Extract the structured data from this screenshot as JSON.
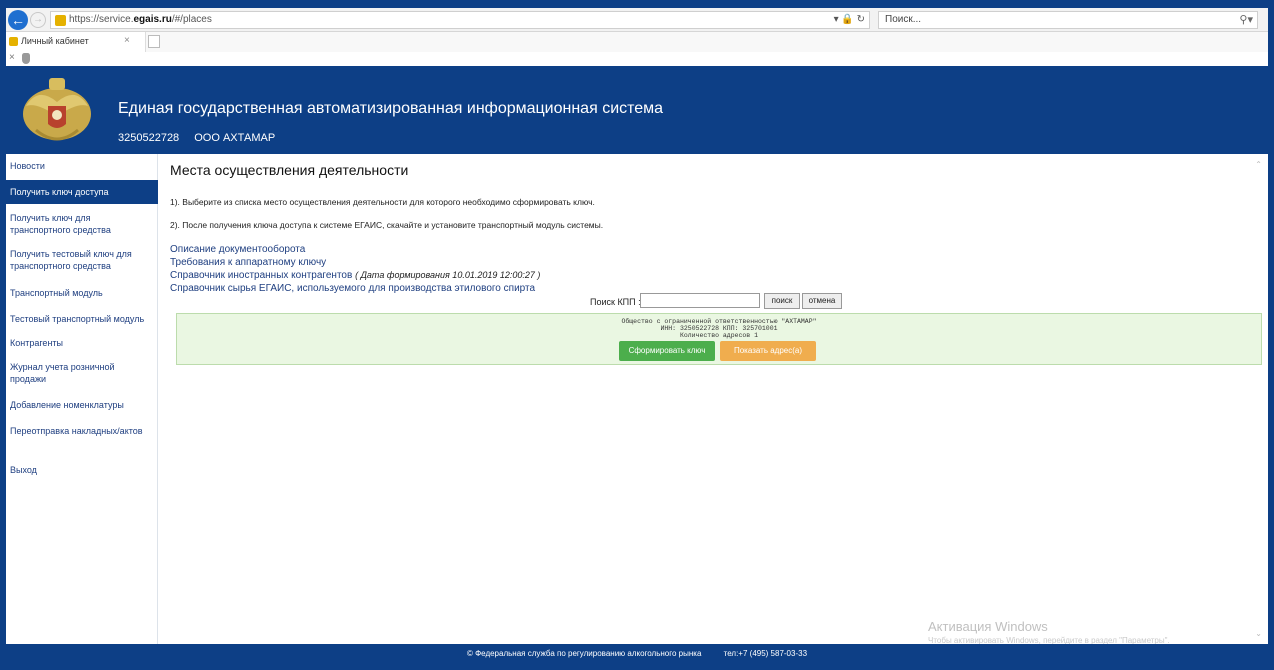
{
  "browser": {
    "url_prefix": "https://service.",
    "url_domain": "egais.ru",
    "url_path": "/#/places",
    "search_placeholder": "Поиск...",
    "tab_title": "Личный кабинет"
  },
  "header": {
    "title": "Единая государственная автоматизированная информационная система",
    "inn": "3250522728",
    "org": "ООО АХТАМАР"
  },
  "sidebar": {
    "items": [
      {
        "label": "Новости"
      },
      {
        "label": "Получить ключ доступа"
      },
      {
        "label": "Получить ключ для транспортного средства"
      },
      {
        "label": "Получить тестовый ключ для транспортного средства"
      },
      {
        "label": "Транспортный модуль"
      },
      {
        "label": "Тестовый транспортный модуль"
      },
      {
        "label": "Контрагенты"
      },
      {
        "label": "Журнал учета розничной продажи"
      },
      {
        "label": "Добавление номенклатуры"
      },
      {
        "label": "Переотправка накладных/актов"
      },
      {
        "label": "Выход"
      }
    ]
  },
  "main": {
    "title": "Места осуществления деятельности",
    "instructions": [
      "1). Выберите из списка место осуществления деятельности для которого необходимо сформировать ключ.",
      "2). После получения ключа доступа к системе ЕГАИС, скачайте и установите транспортный модуль системы."
    ],
    "links": [
      {
        "label": "Описание документооборота",
        "note": ""
      },
      {
        "label": "Требования к аппаратному ключу",
        "note": ""
      },
      {
        "label": "Справочник иностранных контрагентов",
        "note": "( Дата формирования 10.01.2019 12:00:27 )"
      },
      {
        "label": "Справочник сырья ЕГАИС, используемого для производства этилового спирта",
        "note": ""
      }
    ],
    "search": {
      "label": "Поиск КПП :",
      "value": "",
      "search_button": "поиск",
      "cancel_button": "отмена"
    },
    "org_card": {
      "line1": "Общество с ограниченной ответственностью \"АХТАМАР\"",
      "line2": "ИНН: 3250522728 КПП: 325701001",
      "line3": "Количество адресов 1",
      "generate_button": "Сформировать ключ",
      "show_button": "Показать адрес(а)"
    }
  },
  "watermark": {
    "title": "Активация Windows",
    "subtitle": "Чтобы активировать Windows, перейдите в раздел \"Параметры\"."
  },
  "footer": {
    "copyright": "© Федеральная служба по регулированию алкогольного рынка",
    "phone": "тел:+7 (495) 587-03-33"
  }
}
